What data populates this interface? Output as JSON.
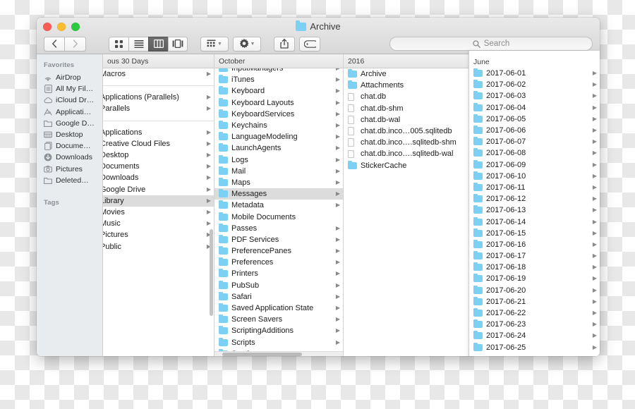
{
  "window": {
    "title": "Archive",
    "title_icon": "folder-icon"
  },
  "toolbar": {
    "back_icon": "chevron-left-icon",
    "forward_icon": "chevron-right-icon",
    "view_icon_label": "icon-view-icon",
    "view_list_label": "list-view-icon",
    "view_column_label": "column-view-icon",
    "view_coverflow_label": "coverflow-view-icon",
    "arrange_label": "arrange-icon",
    "action_label": "gear-icon",
    "share_label": "share-icon",
    "tag_label": "tag-icon",
    "search": {
      "placeholder": "Search",
      "value": "",
      "icon": "search-icon"
    }
  },
  "sidebar": {
    "sections": [
      {
        "header": "Favorites",
        "items": [
          {
            "label": "AirDrop",
            "icon": "airdrop-icon"
          },
          {
            "label": "All My Fil…",
            "icon": "all-my-files-icon"
          },
          {
            "label": "iCloud Dr…",
            "icon": "icloud-icon"
          },
          {
            "label": "Applicati…",
            "icon": "applications-icon"
          },
          {
            "label": "Google D…",
            "icon": "folder-icon"
          },
          {
            "label": "Desktop",
            "icon": "desktop-icon"
          },
          {
            "label": "Docume…",
            "icon": "documents-icon"
          },
          {
            "label": "Downloads",
            "icon": "downloads-icon"
          },
          {
            "label": "Pictures",
            "icon": "pictures-icon"
          },
          {
            "label": "Deleted…",
            "icon": "folder-icon"
          }
        ]
      },
      {
        "header": "Tags",
        "items": []
      }
    ]
  },
  "columns": [
    {
      "header": "ous 30 Days",
      "groups": [
        [
          {
            "name": "Macros",
            "type": "folder",
            "arrow": true,
            "selected": false
          }
        ],
        [
          {
            "name": "Applications (Parallels)",
            "type": "folder",
            "arrow": true,
            "selected": false
          },
          {
            "name": "Parallels",
            "type": "folder",
            "arrow": true,
            "selected": false
          }
        ],
        [
          {
            "name": "Applications",
            "type": "folder",
            "arrow": true,
            "selected": false
          },
          {
            "name": "Creative Cloud Files",
            "type": "folder",
            "arrow": true,
            "selected": false
          },
          {
            "name": "Desktop",
            "type": "folder",
            "arrow": true,
            "selected": false
          },
          {
            "name": "Documents",
            "type": "folder",
            "arrow": true,
            "selected": false
          },
          {
            "name": "Downloads",
            "type": "folder",
            "arrow": true,
            "selected": false
          },
          {
            "name": "Google Drive",
            "type": "folder",
            "arrow": true,
            "selected": false
          },
          {
            "name": "Library",
            "type": "folder",
            "arrow": true,
            "selected": true
          },
          {
            "name": "Movies",
            "type": "folder",
            "arrow": true,
            "selected": false
          },
          {
            "name": "Music",
            "type": "folder",
            "arrow": true,
            "selected": false
          },
          {
            "name": "Pictures",
            "type": "folder",
            "arrow": true,
            "selected": false
          },
          {
            "name": "Public",
            "type": "folder",
            "arrow": true,
            "selected": false
          }
        ]
      ]
    },
    {
      "header": "October",
      "items": [
        {
          "name": "InputManagers",
          "type": "folder",
          "arrow": true,
          "selected": false,
          "clipped": true
        },
        {
          "name": "iTunes",
          "type": "folder",
          "arrow": true,
          "selected": false
        },
        {
          "name": "Keyboard",
          "type": "folder",
          "arrow": true,
          "selected": false
        },
        {
          "name": "Keyboard Layouts",
          "type": "folder",
          "arrow": true,
          "selected": false
        },
        {
          "name": "KeyboardServices",
          "type": "folder",
          "arrow": true,
          "selected": false
        },
        {
          "name": "Keychains",
          "type": "folder",
          "arrow": true,
          "selected": false
        },
        {
          "name": "LanguageModeling",
          "type": "folder",
          "arrow": true,
          "selected": false
        },
        {
          "name": "LaunchAgents",
          "type": "folder",
          "arrow": true,
          "selected": false
        },
        {
          "name": "Logs",
          "type": "folder",
          "arrow": true,
          "selected": false
        },
        {
          "name": "Mail",
          "type": "folder",
          "arrow": true,
          "selected": false
        },
        {
          "name": "Maps",
          "type": "folder",
          "arrow": true,
          "selected": false
        },
        {
          "name": "Messages",
          "type": "folder",
          "arrow": true,
          "selected": true
        },
        {
          "name": "Metadata",
          "type": "folder",
          "arrow": true,
          "selected": false
        },
        {
          "name": "Mobile Documents",
          "type": "folder",
          "arrow": false,
          "selected": false
        },
        {
          "name": "Passes",
          "type": "folder",
          "arrow": true,
          "selected": false
        },
        {
          "name": "PDF Services",
          "type": "folder",
          "arrow": true,
          "selected": false
        },
        {
          "name": "PreferencePanes",
          "type": "folder",
          "arrow": true,
          "selected": false
        },
        {
          "name": "Preferences",
          "type": "folder",
          "arrow": true,
          "selected": false
        },
        {
          "name": "Printers",
          "type": "folder",
          "arrow": true,
          "selected": false
        },
        {
          "name": "PubSub",
          "type": "folder",
          "arrow": true,
          "selected": false
        },
        {
          "name": "Safari",
          "type": "folder",
          "arrow": true,
          "selected": false
        },
        {
          "name": "Saved Application State",
          "type": "folder",
          "arrow": true,
          "selected": false
        },
        {
          "name": "Screen Savers",
          "type": "folder",
          "arrow": true,
          "selected": false
        },
        {
          "name": "ScriptingAdditions",
          "type": "folder",
          "arrow": true,
          "selected": false
        },
        {
          "name": "Scripts",
          "type": "folder",
          "arrow": true,
          "selected": false
        },
        {
          "name": "Services",
          "type": "folder",
          "arrow": true,
          "selected": false,
          "clipped": true
        }
      ]
    },
    {
      "header": "2016",
      "items": [
        {
          "name": "Archive",
          "type": "folder",
          "arrow": true,
          "selected": false
        },
        {
          "name": "Attachments",
          "type": "folder",
          "arrow": true,
          "selected": false
        },
        {
          "name": "chat.db",
          "type": "file",
          "arrow": false,
          "selected": false
        },
        {
          "name": "chat.db-shm",
          "type": "file",
          "arrow": false,
          "selected": false
        },
        {
          "name": "chat.db-wal",
          "type": "file",
          "arrow": false,
          "selected": false
        },
        {
          "name": "chat.db.inco…005.sqlitedb",
          "type": "file",
          "arrow": false,
          "selected": false
        },
        {
          "name": "chat.db.inco….sqlitedb-shm",
          "type": "file",
          "arrow": false,
          "selected": false
        },
        {
          "name": "chat.db.inco….sqlitedb-wal",
          "type": "file",
          "arrow": false,
          "selected": false
        },
        {
          "name": "StickerCache",
          "type": "folder",
          "arrow": true,
          "selected": false
        }
      ]
    },
    {
      "header": "June",
      "items": [
        {
          "name": "2017-06-01",
          "type": "folder",
          "arrow": true,
          "selected": false
        },
        {
          "name": "2017-06-02",
          "type": "folder",
          "arrow": true,
          "selected": false
        },
        {
          "name": "2017-06-03",
          "type": "folder",
          "arrow": true,
          "selected": false
        },
        {
          "name": "2017-06-04",
          "type": "folder",
          "arrow": true,
          "selected": false
        },
        {
          "name": "2017-06-05",
          "type": "folder",
          "arrow": true,
          "selected": false
        },
        {
          "name": "2017-06-06",
          "type": "folder",
          "arrow": true,
          "selected": false
        },
        {
          "name": "2017-06-07",
          "type": "folder",
          "arrow": true,
          "selected": false
        },
        {
          "name": "2017-06-08",
          "type": "folder",
          "arrow": true,
          "selected": false
        },
        {
          "name": "2017-06-09",
          "type": "folder",
          "arrow": true,
          "selected": false
        },
        {
          "name": "2017-06-10",
          "type": "folder",
          "arrow": true,
          "selected": false
        },
        {
          "name": "2017-06-11",
          "type": "folder",
          "arrow": true,
          "selected": false
        },
        {
          "name": "2017-06-12",
          "type": "folder",
          "arrow": true,
          "selected": false
        },
        {
          "name": "2017-06-13",
          "type": "folder",
          "arrow": true,
          "selected": false
        },
        {
          "name": "2017-06-14",
          "type": "folder",
          "arrow": true,
          "selected": false
        },
        {
          "name": "2017-06-15",
          "type": "folder",
          "arrow": true,
          "selected": false
        },
        {
          "name": "2017-06-16",
          "type": "folder",
          "arrow": true,
          "selected": false
        },
        {
          "name": "2017-06-17",
          "type": "folder",
          "arrow": true,
          "selected": false
        },
        {
          "name": "2017-06-18",
          "type": "folder",
          "arrow": true,
          "selected": false
        },
        {
          "name": "2017-06-19",
          "type": "folder",
          "arrow": true,
          "selected": false
        },
        {
          "name": "2017-06-20",
          "type": "folder",
          "arrow": true,
          "selected": false
        },
        {
          "name": "2017-06-21",
          "type": "folder",
          "arrow": true,
          "selected": false
        },
        {
          "name": "2017-06-22",
          "type": "folder",
          "arrow": true,
          "selected": false
        },
        {
          "name": "2017-06-23",
          "type": "folder",
          "arrow": true,
          "selected": false
        },
        {
          "name": "2017-06-24",
          "type": "folder",
          "arrow": true,
          "selected": false
        },
        {
          "name": "2017-06-25",
          "type": "folder",
          "arrow": true,
          "selected": false,
          "clipped": true
        }
      ]
    }
  ],
  "colors": {
    "folder_blue": "#7cd0f3",
    "selection_gray": "#dcdcdc",
    "sidebar_bg": "#e9ecef"
  }
}
